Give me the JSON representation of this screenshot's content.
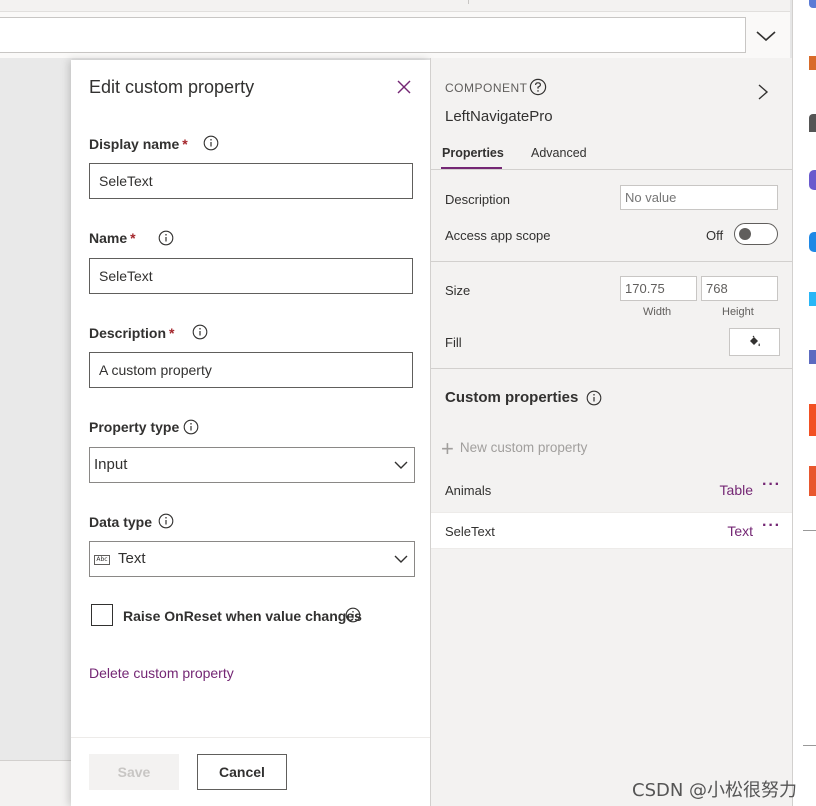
{
  "formula_bar": {
    "value": ""
  },
  "edit_panel": {
    "title": "Edit custom property",
    "display_name": {
      "label": "Display name",
      "required_mark": "*",
      "value": "SeleText"
    },
    "name": {
      "label": "Name",
      "required_mark": "*",
      "value": "SeleText"
    },
    "description": {
      "label": "Description",
      "required_mark": "*",
      "value": "A custom property"
    },
    "property_type": {
      "label": "Property type",
      "selected": "Input"
    },
    "data_type": {
      "label": "Data type",
      "icon_text": "Abc",
      "selected": "Text"
    },
    "raise_onreset": {
      "label": "Raise OnReset when value changes",
      "checked": false
    },
    "delete_link": "Delete custom property",
    "save_label": "Save",
    "cancel_label": "Cancel"
  },
  "properties_panel": {
    "component_label": "COMPONENT",
    "component_name": "LeftNavigatePro",
    "tabs": [
      {
        "label": "Properties",
        "active": true
      },
      {
        "label": "Advanced",
        "active": false
      }
    ],
    "description": {
      "label": "Description",
      "placeholder": "No value"
    },
    "access_scope": {
      "label": "Access app scope",
      "state": "Off"
    },
    "size": {
      "label": "Size",
      "width": "170.75",
      "height": "768",
      "width_label": "Width",
      "height_label": "Height"
    },
    "fill": {
      "label": "Fill"
    },
    "custom_properties": {
      "title": "Custom properties",
      "new_label": "New custom property",
      "items": [
        {
          "name": "Animals",
          "type": "Table",
          "more": "···"
        },
        {
          "name": "SeleText",
          "type": "Text",
          "more": "···"
        }
      ]
    }
  },
  "watermark": "CSDN @小松很努力",
  "colors": {
    "accent": "#742774",
    "required": "#a4262c",
    "panel_bg": "#f3f2f1"
  }
}
